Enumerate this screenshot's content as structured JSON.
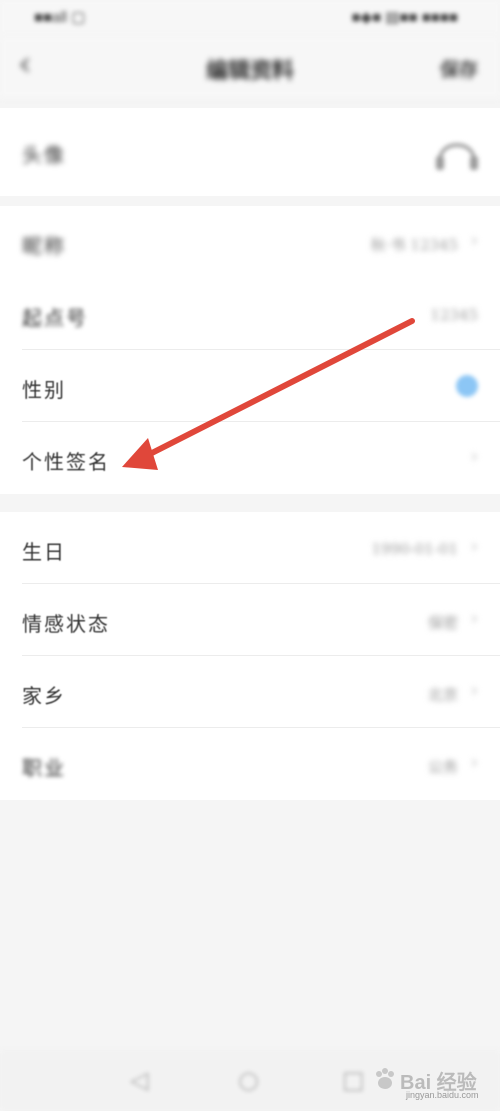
{
  "status_bar": {
    "left": "■■all ▢",
    "right": "■◆■ ▤■■ ■■■■"
  },
  "nav": {
    "back_icon": "chevron-left",
    "title": "编辑资料",
    "save_label": "保存"
  },
  "profile": {
    "avatar": {
      "label": "头像"
    },
    "nickname": {
      "label": "昵称",
      "value": "秋·书 12345"
    },
    "qidian_id": {
      "label": "起点号",
      "value": "12345"
    },
    "gender": {
      "label": "性别"
    },
    "signature": {
      "label": "个性签名",
      "value": ""
    }
  },
  "details": {
    "birthday": {
      "label": "生日",
      "value": "1990-01-01"
    },
    "relationship": {
      "label": "情感状态",
      "value": "保密"
    },
    "hometown": {
      "label": "家乡",
      "value": "北京"
    },
    "occupation": {
      "label": "职业",
      "value": "公务"
    }
  },
  "bottom_nav": {
    "back": "◁",
    "home": "○",
    "recent": "□"
  },
  "watermark": {
    "text": "Bai 经验",
    "sub": "jingyan.baidu.com"
  },
  "annotation": {
    "arrow_color": "#e0473a"
  }
}
